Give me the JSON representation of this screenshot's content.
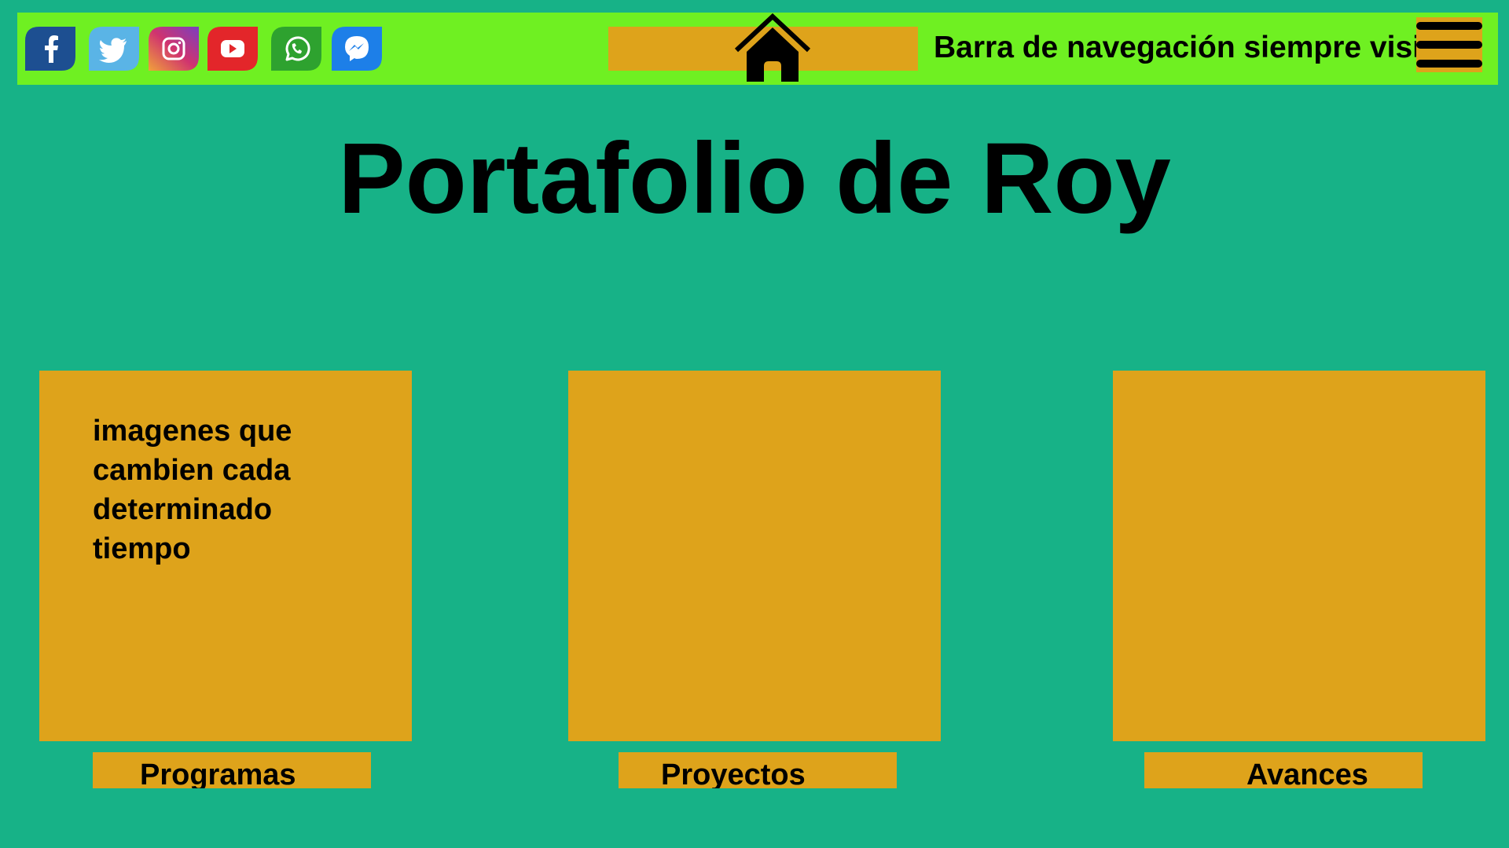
{
  "navbar": {
    "social": [
      {
        "icon": "facebook-icon",
        "color": "#1d4f91"
      },
      {
        "icon": "twitter-icon",
        "color": "#5ab4e6"
      },
      {
        "icon": "instagram-icon",
        "color": "#c0398f"
      },
      {
        "icon": "youtube-icon",
        "color": "#e3262a"
      },
      {
        "icon": "whatsapp-icon",
        "color": "#2ea22f"
      },
      {
        "icon": "messenger-icon",
        "color": "#1d7fe8"
      }
    ],
    "home_icon": "home-icon",
    "note": "Barra de navegación siempre visible",
    "menu_icon": "hamburger-menu-icon"
  },
  "title": "Portafolio de Roy",
  "cards": [
    {
      "text": "imagenes que cambien cada determinado tiempo",
      "label": "Programas"
    },
    {
      "text": "",
      "label": "Proyectos"
    },
    {
      "text": "",
      "label": "Avances"
    }
  ],
  "colors": {
    "background": "#17b287",
    "navbar": "#6ff022",
    "card": "#dea31b"
  }
}
